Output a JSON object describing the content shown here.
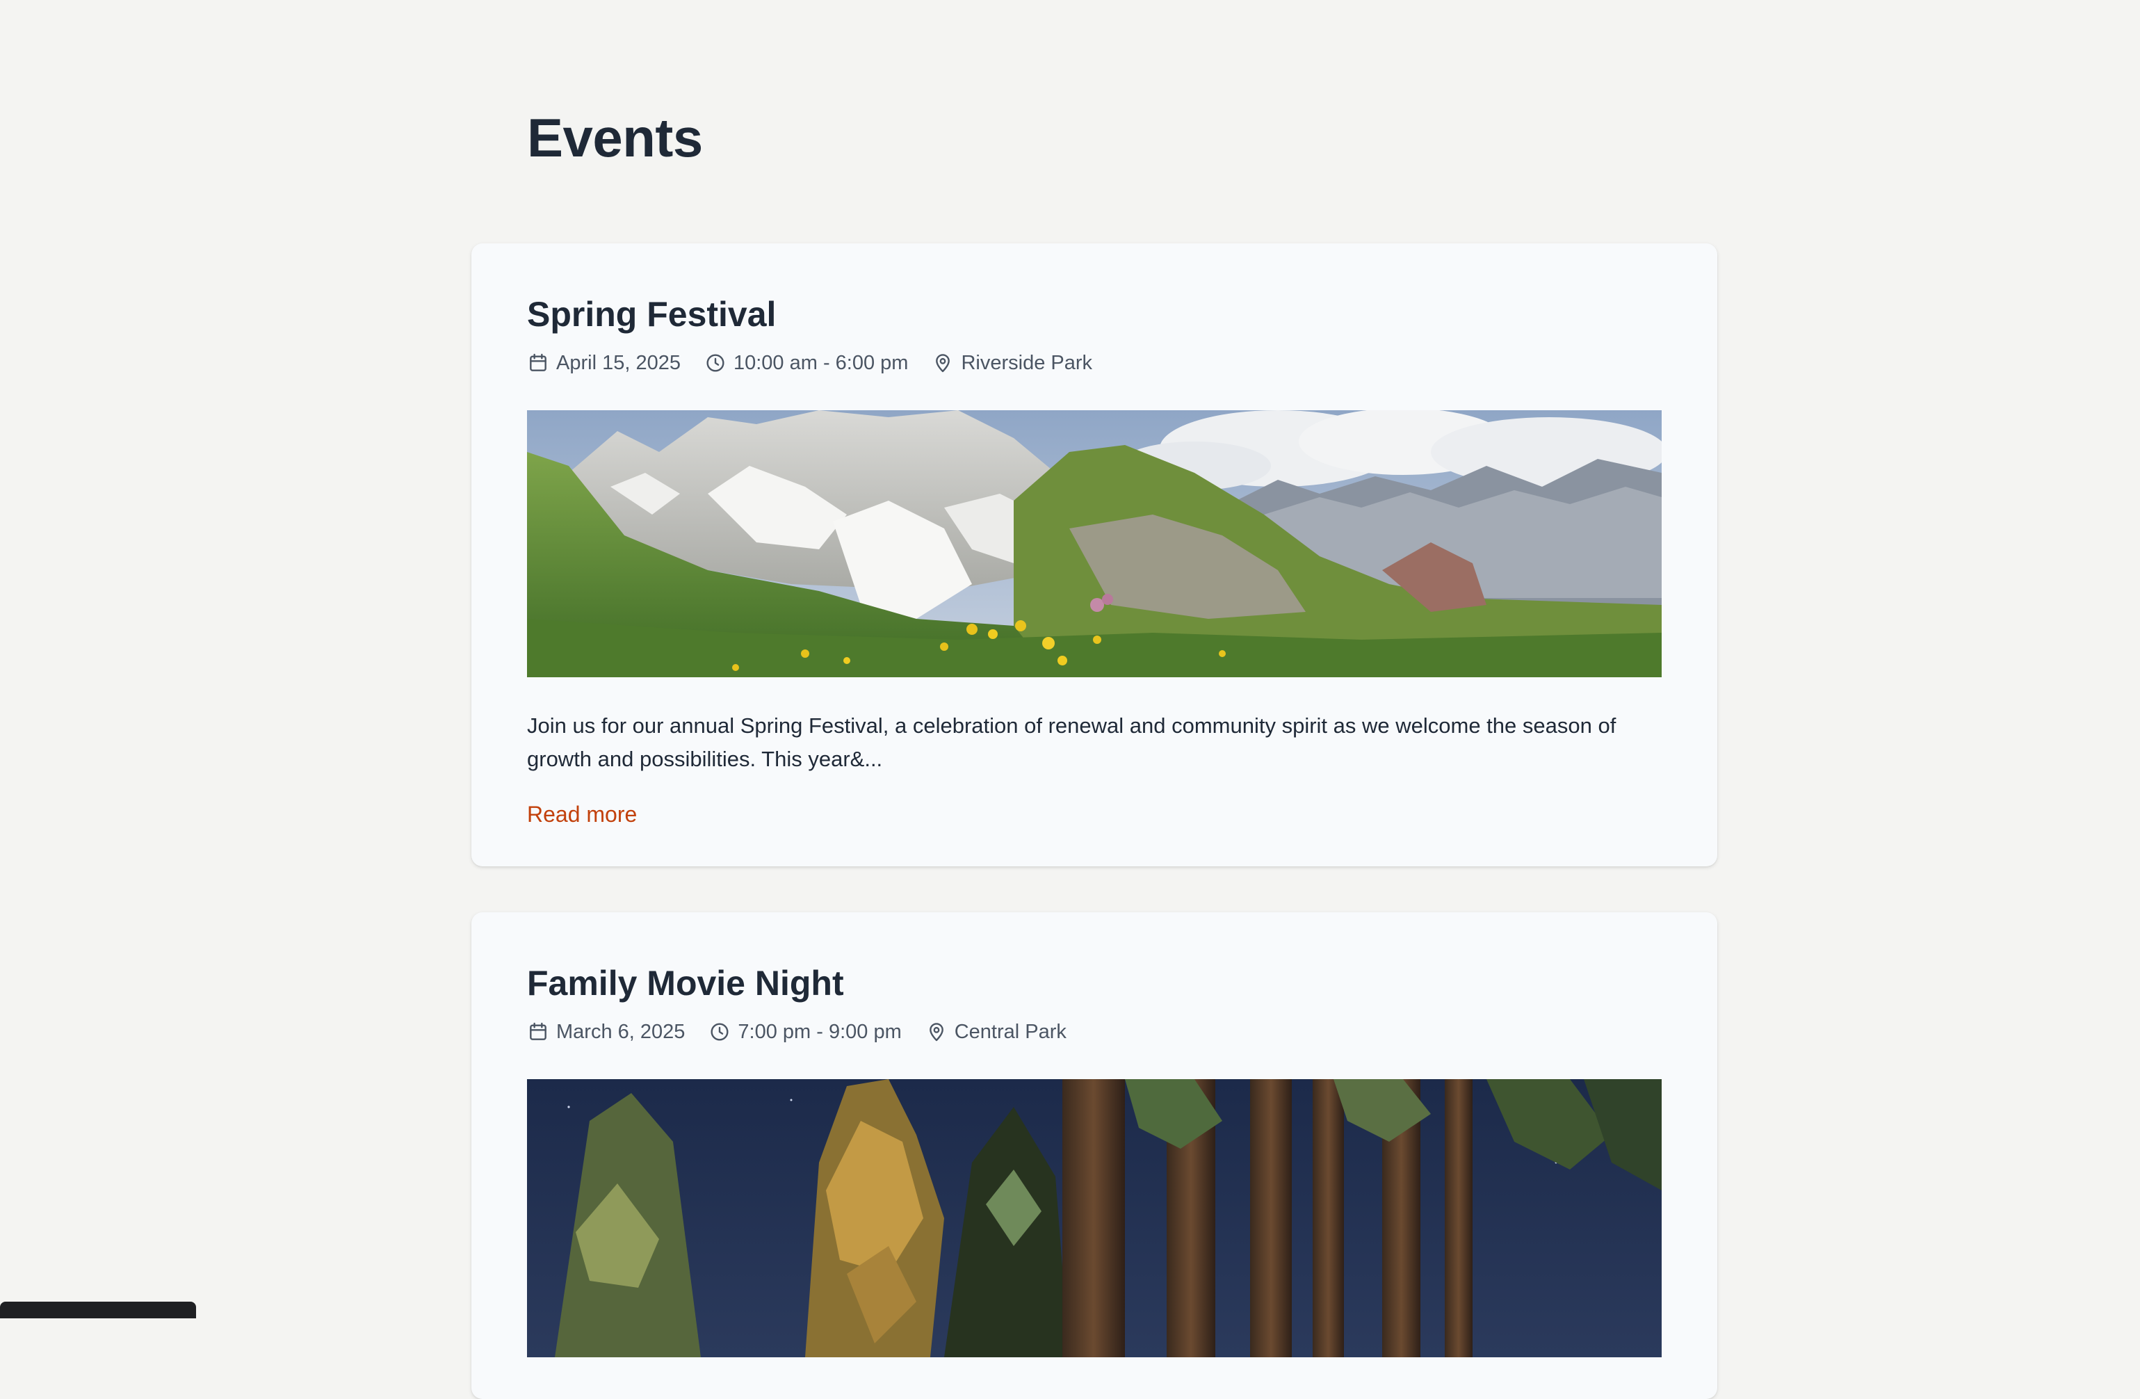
{
  "page": {
    "title": "Events"
  },
  "events": [
    {
      "title": "Spring Festival",
      "date": "April 15, 2025",
      "time": "10:00 am - 6:00 pm",
      "location": "Riverside Park",
      "excerpt": "Join us for our annual Spring Festival, a celebration of renewal and community spirit as we welcome the season of growth and possibilities. This year&...",
      "read_more": "Read more",
      "image": "mountain-meadow-photo"
    },
    {
      "title": "Family Movie Night",
      "date": "March 6, 2025",
      "time": "7:00 pm - 9:00 pm",
      "location": "Central Park",
      "image": "night-forest-photo"
    }
  ],
  "icons": {
    "date": "calendar-icon",
    "time": "clock-icon",
    "location": "map-pin-icon"
  },
  "colors": {
    "page_background": "#f4f4f2",
    "card_background": "#f8fafc",
    "heading": "#1f2937",
    "meta_text": "#4b5563",
    "link": "#c2410c"
  }
}
